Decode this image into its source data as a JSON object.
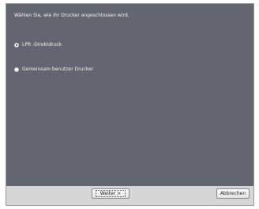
{
  "dialog": {
    "prompt": "Wählen Sie, wie Ihr Drucker angeschlossen wird.",
    "options": [
      {
        "label": "LPR -Direktdruck",
        "selected": true
      },
      {
        "label": "Gemeinsam benutzer Drucker",
        "selected": false
      }
    ]
  },
  "buttons": {
    "next": "Weiter >",
    "cancel": "Abbrechen"
  },
  "colors": {
    "panel": "#636670",
    "footer": "#d6d6d6"
  }
}
